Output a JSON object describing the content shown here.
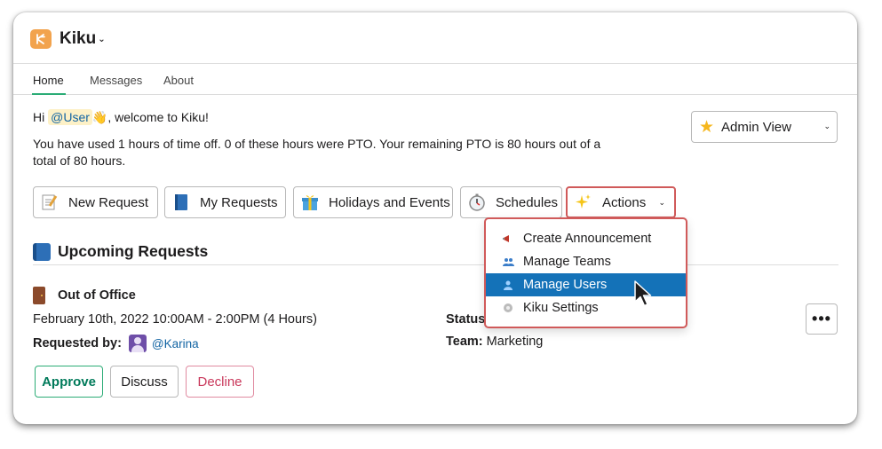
{
  "app": {
    "title": "Kiku",
    "accent": "#2bac76",
    "logo_color": "#f2a34d"
  },
  "tabs": [
    {
      "label": "Home",
      "active": true
    },
    {
      "label": "Messages",
      "active": false
    },
    {
      "label": "About",
      "active": false
    }
  ],
  "greeting": {
    "prefix": "Hi ",
    "mention": "@User",
    "emoji": "👋",
    "suffix": ", welcome to Kiku!"
  },
  "usage_text": "You have used 1 hours of time off. 0 of these hours were PTO. Your remaining PTO is 80 hours out of a total of 80 hours.",
  "view_select": {
    "icon": "star-icon",
    "value": "Admin View"
  },
  "buttons": [
    {
      "label": "New Request",
      "icon": "memo-icon"
    },
    {
      "label": "My Requests",
      "icon": "book-icon"
    },
    {
      "label": "Holidays and Events",
      "icon": "gift-icon"
    },
    {
      "label": "Schedules",
      "icon": "stopwatch-icon"
    },
    {
      "label": "Actions",
      "icon": "sparkles-icon"
    }
  ],
  "actions_menu": {
    "items": [
      {
        "label": "Create Announcement",
        "icon": "megaphone-icon",
        "selected": false
      },
      {
        "label": "Manage Teams",
        "icon": "people-icon",
        "selected": false
      },
      {
        "label": "Manage Users",
        "icon": "person-icon",
        "selected": true
      },
      {
        "label": "Kiku Settings",
        "icon": "gear-icon",
        "selected": false
      }
    ]
  },
  "upcoming": {
    "title": "Upcoming Requests",
    "request": {
      "type": "Out of Office",
      "date": "February 10th, 2022 10:00AM - 2:00PM (4 Hours)",
      "requested_by_label": "Requested by:",
      "requested_by": "@Karina",
      "status_label": "Status:",
      "team_label": "Team:",
      "team": "Marketing",
      "more": "•••",
      "actions": {
        "approve": "Approve",
        "discuss": "Discuss",
        "decline": "Decline"
      }
    }
  }
}
